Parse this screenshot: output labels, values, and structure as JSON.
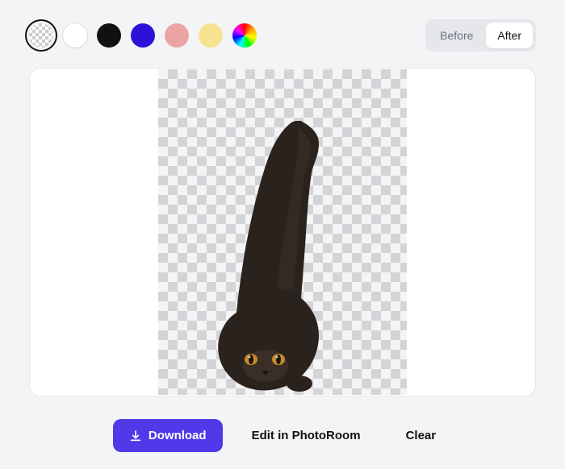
{
  "swatches": [
    {
      "name": "transparent",
      "selected": true
    },
    {
      "name": "white",
      "selected": false
    },
    {
      "name": "black",
      "selected": false
    },
    {
      "name": "blue",
      "selected": false
    },
    {
      "name": "pink",
      "selected": false
    },
    {
      "name": "yellow",
      "selected": false
    },
    {
      "name": "rainbow",
      "selected": false
    }
  ],
  "toggle": {
    "before": "Before",
    "after": "After",
    "active": "after"
  },
  "canvas": {
    "subject": "cat"
  },
  "actions": {
    "download": "Download",
    "edit": "Edit in PhotoRoom",
    "clear": "Clear"
  }
}
